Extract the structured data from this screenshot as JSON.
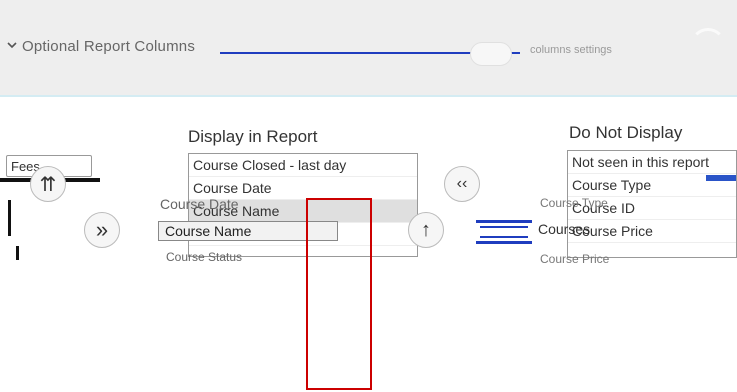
{
  "header": {
    "title": "Optional Report Columns",
    "collapse_icon": "chevron-down-icon",
    "ghost_text": "columns settings"
  },
  "columns": {
    "display_label": "Display in Report",
    "not_display_label": "Do Not Display"
  },
  "left_field": {
    "value": "Fees"
  },
  "display_list": {
    "items": [
      "Course Closed - last day",
      "Course Date",
      "Course Name",
      "Course Status"
    ]
  },
  "not_display_list": {
    "items": [
      "Not seen in this report",
      "Course Type",
      "Course ID",
      "Course Price"
    ]
  },
  "overlays": {
    "course_name_label": "Course Name",
    "courses_label": "Courses",
    "ghost_a": "Course Date",
    "ghost_b": "Course Status",
    "ghost_c": "Course Type",
    "ghost_d": "Course Price"
  },
  "buttons": {
    "move_all_right": "»",
    "move_up": "↑",
    "move_top": "⇈",
    "move_left": "‹‹"
  },
  "colors": {
    "accent_blue": "#1f3dbf",
    "highlight_red": "#cc0000",
    "topbar_bg": "#eeeeee"
  }
}
